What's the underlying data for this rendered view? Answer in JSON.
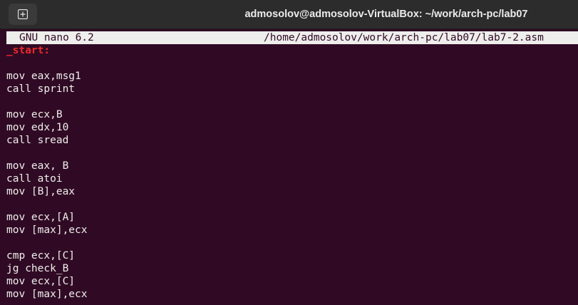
{
  "window": {
    "title": "admosolov@admosolov-VirtualBox: ~/work/arch-pc/lab07"
  },
  "nano": {
    "version": "GNU nano 6.2",
    "filepath": "/home/admosolov/work/arch-pc/lab07/lab7-2.asm"
  },
  "code": {
    "lines": [
      "_start:",
      "",
      "mov eax,msg1",
      "call sprint",
      "",
      "mov ecx,B",
      "mov edx,10",
      "call sread",
      "",
      "mov eax, B",
      "call atoi",
      "mov [B],eax",
      "",
      "mov ecx,[A]",
      "mov [max],ecx",
      "",
      "cmp ecx,[C]",
      "jg check_B",
      "mov ecx,[C]",
      "mov [max],ecx"
    ]
  },
  "colors": {
    "terminal_bg": "#300a24",
    "titlebar_bg": "#2c2c2c",
    "text": "#eeeeec",
    "label": "#ef2929"
  },
  "icons": {
    "new_tab": "new-tab-icon"
  }
}
